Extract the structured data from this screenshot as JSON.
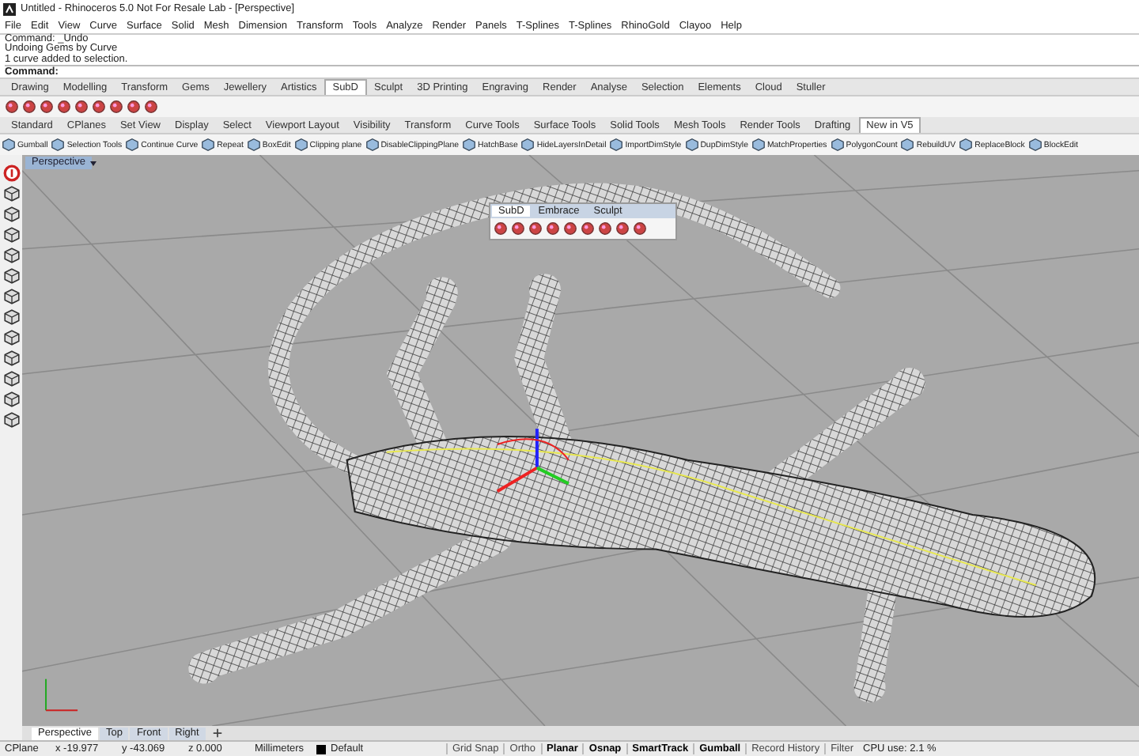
{
  "window": {
    "title": "Untitled - Rhinoceros 5.0 Not For Resale Lab - [Perspective]"
  },
  "menu": [
    "File",
    "Edit",
    "View",
    "Curve",
    "Surface",
    "Solid",
    "Mesh",
    "Dimension",
    "Transform",
    "Tools",
    "Analyze",
    "Render",
    "Panels",
    "T-Splines",
    "T-Splines",
    "RhinoGold",
    "Clayoo",
    "Help"
  ],
  "command_history": [
    "Command: _Undo",
    "Undoing Gems by Curve",
    "1 curve added to selection."
  ],
  "command_prompt": "Command:",
  "tab_rows": [
    {
      "tabs": [
        {
          "label": "Drawing",
          "selected": false
        },
        {
          "label": "Modelling",
          "selected": false
        },
        {
          "label": "Transform",
          "selected": false
        },
        {
          "label": "Gems",
          "selected": false
        },
        {
          "label": "Jewellery",
          "selected": false
        },
        {
          "label": "Artistics",
          "selected": false
        },
        {
          "label": "SubD",
          "selected": true
        },
        {
          "label": "Sculpt",
          "selected": false
        },
        {
          "label": "3D Printing",
          "selected": false
        },
        {
          "label": "Engraving",
          "selected": false
        },
        {
          "label": "Render",
          "selected": false
        },
        {
          "label": "Analyse",
          "selected": false
        },
        {
          "label": "Selection",
          "selected": false
        },
        {
          "label": "Elements",
          "selected": false
        },
        {
          "label": "Cloud",
          "selected": false
        },
        {
          "label": "Stuller",
          "selected": false
        }
      ]
    },
    {
      "tabs": [
        {
          "label": "Standard",
          "selected": false
        },
        {
          "label": "CPlanes",
          "selected": false
        },
        {
          "label": "Set View",
          "selected": false
        },
        {
          "label": "Display",
          "selected": false
        },
        {
          "label": "Select",
          "selected": false
        },
        {
          "label": "Viewport Layout",
          "selected": false
        },
        {
          "label": "Visibility",
          "selected": false
        },
        {
          "label": "Transform",
          "selected": false
        },
        {
          "label": "Curve Tools",
          "selected": false
        },
        {
          "label": "Surface Tools",
          "selected": false
        },
        {
          "label": "Solid Tools",
          "selected": false
        },
        {
          "label": "Mesh Tools",
          "selected": false
        },
        {
          "label": "Render Tools",
          "selected": false
        },
        {
          "label": "Drafting",
          "selected": false
        },
        {
          "label": "New in V5",
          "selected": true
        }
      ]
    }
  ],
  "tools": [
    "Gumball",
    "Selection Tools",
    "Continue Curve",
    "Repeat",
    "BoxEdit",
    "Clipping plane",
    "DisableClippingPlane",
    "HatchBase",
    "HideLayersInDetail",
    "ImportDimStyle",
    "DupDimStyle",
    "MatchProperties",
    "PolygonCount",
    "RebuildUV",
    "ReplaceBlock",
    "BlockEdit"
  ],
  "viewport": {
    "title": "Perspective"
  },
  "floating_panel": {
    "tabs": [
      {
        "label": "SubD",
        "selected": true
      },
      {
        "label": "Embrace",
        "selected": false
      },
      {
        "label": "Sculpt",
        "selected": false
      }
    ]
  },
  "viewport_tabs": [
    {
      "label": "Perspective",
      "selected": true
    },
    {
      "label": "Top",
      "selected": false
    },
    {
      "label": "Front",
      "selected": false
    },
    {
      "label": "Right",
      "selected": false
    }
  ],
  "status_bar": {
    "cplane": "CPlane",
    "x": "x -19.977",
    "y": "y -43.069",
    "z": "z 0.000",
    "units": "Millimeters",
    "layer": "Default",
    "toggles": [
      {
        "label": "Grid Snap",
        "on": false
      },
      {
        "label": "Ortho",
        "on": false
      },
      {
        "label": "Planar",
        "on": true
      },
      {
        "label": "Osnap",
        "on": true
      },
      {
        "label": "SmartTrack",
        "on": true
      },
      {
        "label": "Gumball",
        "on": true
      },
      {
        "label": "Record History",
        "on": false
      },
      {
        "label": "Filter",
        "on": false
      }
    ],
    "cpu": "CPU use: 2.1 %"
  }
}
